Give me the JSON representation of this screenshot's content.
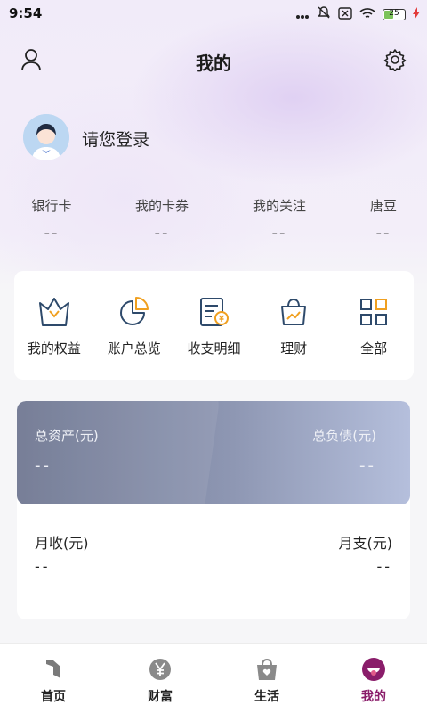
{
  "status_bar": {
    "time": "9:54",
    "battery": "25"
  },
  "header": {
    "title": "我的"
  },
  "login": {
    "prompt": "请您登录"
  },
  "stats": [
    {
      "label": "银行卡",
      "value": "--"
    },
    {
      "label": "我的卡券",
      "value": "--"
    },
    {
      "label": "我的关注",
      "value": "--"
    },
    {
      "label": "唐豆",
      "value": "--"
    }
  ],
  "menu": [
    {
      "label": "我的权益",
      "icon": "crown-icon"
    },
    {
      "label": "账户总览",
      "icon": "pie-chart-icon"
    },
    {
      "label": "收支明细",
      "icon": "bill-icon"
    },
    {
      "label": "理财",
      "icon": "wealth-bag-icon"
    },
    {
      "label": "全部",
      "icon": "grid-icon"
    }
  ],
  "assets": {
    "total_assets_label": "总资产(元)",
    "total_assets_value": "--",
    "total_liabilities_label": "总负债(元)",
    "total_liabilities_value": "--",
    "monthly_income_label": "月收(元)",
    "monthly_income_value": "--",
    "monthly_expense_label": "月支(元)",
    "monthly_expense_value": "--"
  },
  "tabbar": {
    "items": [
      {
        "label": "首页",
        "icon": "home-icon"
      },
      {
        "label": "财富",
        "icon": "yen-icon"
      },
      {
        "label": "生活",
        "icon": "shopping-bag-icon"
      },
      {
        "label": "我的",
        "icon": "profile-icon",
        "active": true
      }
    ]
  },
  "colors": {
    "accent": "#8a1d6a",
    "icon_blue": "#2e4a6b",
    "icon_orange": "#f0a020"
  }
}
